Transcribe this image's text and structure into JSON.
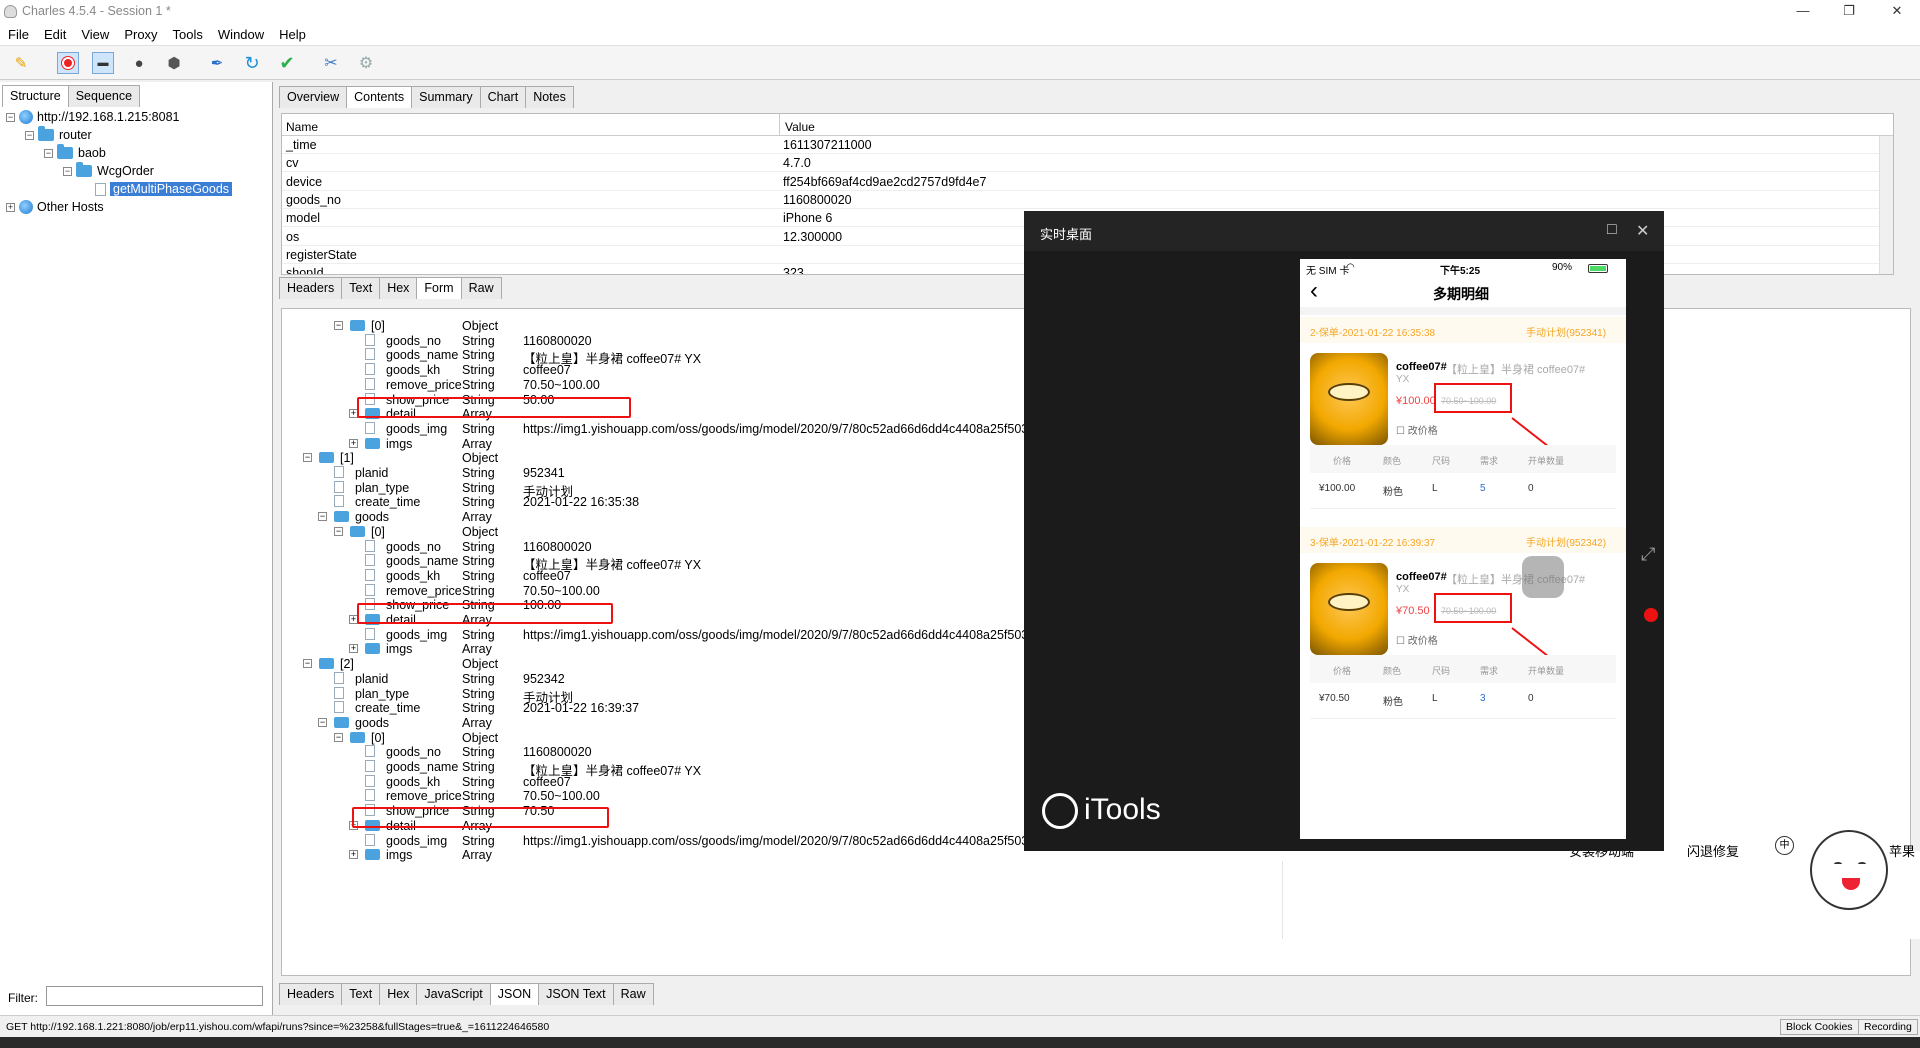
{
  "window": {
    "title": "Charles 4.5.4 - Session 1 *",
    "minimize": "—",
    "restore": "❐",
    "close": "✕"
  },
  "menu": [
    "File",
    "Edit",
    "View",
    "Proxy",
    "Tools",
    "Window",
    "Help"
  ],
  "toolbar_icons": [
    "broom-icon",
    "record-icon",
    "throttle-icon",
    "turtle-icon",
    "stop-icon",
    "pen-icon",
    "refresh-icon",
    "check-icon",
    "tools-icon",
    "settings-icon"
  ],
  "left": {
    "tabs": [
      "Structure",
      "Sequence"
    ],
    "tree": [
      {
        "label": "http://192.168.1.215:8081",
        "indent": 0,
        "icon": "globe",
        "exp": "⊟"
      },
      {
        "label": "router",
        "indent": 1,
        "icon": "folder",
        "exp": "⊟"
      },
      {
        "label": "baob",
        "indent": 2,
        "icon": "folder",
        "exp": "⊟"
      },
      {
        "label": "WcgOrder",
        "indent": 3,
        "icon": "folder",
        "exp": "⊟"
      },
      {
        "label": "getMultiPhaseGoods",
        "indent": 4,
        "icon": "doc",
        "exp": "",
        "selected": true
      },
      {
        "label": "Other Hosts",
        "indent": 0,
        "icon": "globe",
        "exp": "⊞"
      }
    ],
    "filter_label": "Filter:"
  },
  "right": {
    "top_tabs": [
      "Overview",
      "Contents",
      "Summary",
      "Chart",
      "Notes"
    ],
    "table_headers": [
      "Name",
      "Value"
    ],
    "table_rows": [
      {
        "name": "_time",
        "value": "1611307211000"
      },
      {
        "name": "cv",
        "value": "4.7.0"
      },
      {
        "name": "device",
        "value": "ff254bf669af4cd9ae2cd2757d9fd4e7"
      },
      {
        "name": "goods_no",
        "value": "1160800020"
      },
      {
        "name": "model",
        "value": "iPhone 6"
      },
      {
        "name": "os",
        "value": "12.300000"
      },
      {
        "name": "registerState",
        "value": ""
      },
      {
        "name": "shopId",
        "value": "323"
      }
    ],
    "request_tabs": [
      "Headers",
      "Text",
      "Hex",
      "Form",
      "Raw"
    ],
    "response_tabs": [
      "Headers",
      "Text",
      "Hex",
      "JavaScript",
      "JSON",
      "JSON Text",
      "Raw"
    ],
    "json_rows": [
      {
        "level": 3,
        "key": "[0]",
        "type": "Object",
        "value": "",
        "kind": "folder",
        "exp": "⊟"
      },
      {
        "level": 4,
        "key": "goods_no",
        "type": "String",
        "value": "1160800020",
        "kind": "doc"
      },
      {
        "level": 4,
        "key": "goods_name",
        "type": "String",
        "value": "【粒上皇】半身裙  coffee07#  YX",
        "kind": "doc"
      },
      {
        "level": 4,
        "key": "goods_kh",
        "type": "String",
        "value": "coffee07",
        "kind": "doc"
      },
      {
        "level": 4,
        "key": "remove_price",
        "type": "String",
        "value": "70.50~100.00",
        "kind": "doc"
      },
      {
        "level": 4,
        "key": "show_price",
        "type": "String",
        "value": "50.00",
        "kind": "doc"
      },
      {
        "level": 4,
        "key": "detail",
        "type": "Array",
        "value": "",
        "kind": "folder",
        "exp": "⊞"
      },
      {
        "level": 4,
        "key": "goods_img",
        "type": "String",
        "value": "https://img1.yishouapp.com/oss/goods/img/model/2020/9/7/80c52ad66d6dd4c4408a25f503feb19c.jpg?x-oss-process=image/resize,w_75",
        "kind": "doc"
      },
      {
        "level": 4,
        "key": "imgs",
        "type": "Array",
        "value": "",
        "kind": "folder",
        "exp": "⊞"
      },
      {
        "level": 1,
        "key": "[1]",
        "type": "Object",
        "value": "",
        "kind": "folder",
        "exp": "⊟"
      },
      {
        "level": 2,
        "key": "planid",
        "type": "String",
        "value": "952341",
        "kind": "doc"
      },
      {
        "level": 2,
        "key": "plan_type",
        "type": "String",
        "value": "手动计划",
        "kind": "doc"
      },
      {
        "level": 2,
        "key": "create_time",
        "type": "String",
        "value": "2021-01-22 16:35:38",
        "kind": "doc"
      },
      {
        "level": 2,
        "key": "goods",
        "type": "Array",
        "value": "",
        "kind": "folder",
        "exp": "⊟"
      },
      {
        "level": 3,
        "key": "[0]",
        "type": "Object",
        "value": "",
        "kind": "folder",
        "exp": "⊟"
      },
      {
        "level": 4,
        "key": "goods_no",
        "type": "String",
        "value": "1160800020",
        "kind": "doc"
      },
      {
        "level": 4,
        "key": "goods_name",
        "type": "String",
        "value": "【粒上皇】半身裙  coffee07#  YX",
        "kind": "doc"
      },
      {
        "level": 4,
        "key": "goods_kh",
        "type": "String",
        "value": "coffee07",
        "kind": "doc"
      },
      {
        "level": 4,
        "key": "remove_price",
        "type": "String",
        "value": "70.50~100.00",
        "kind": "doc"
      },
      {
        "level": 4,
        "key": "show_price",
        "type": "String",
        "value": "100.00",
        "kind": "doc"
      },
      {
        "level": 4,
        "key": "detail",
        "type": "Array",
        "value": "",
        "kind": "folder",
        "exp": "⊞"
      },
      {
        "level": 4,
        "key": "goods_img",
        "type": "String",
        "value": "https://img1.yishouapp.com/oss/goods/img/model/2020/9/7/80c52ad66d6dd4c4408a25f503feb19c.jpg?x-oss-process=image/resize,w_75",
        "kind": "doc"
      },
      {
        "level": 4,
        "key": "imgs",
        "type": "Array",
        "value": "",
        "kind": "folder",
        "exp": "⊞"
      },
      {
        "level": 1,
        "key": "[2]",
        "type": "Object",
        "value": "",
        "kind": "folder",
        "exp": "⊟"
      },
      {
        "level": 2,
        "key": "planid",
        "type": "String",
        "value": "952342",
        "kind": "doc"
      },
      {
        "level": 2,
        "key": "plan_type",
        "type": "String",
        "value": "手动计划",
        "kind": "doc"
      },
      {
        "level": 2,
        "key": "create_time",
        "type": "String",
        "value": "2021-01-22 16:39:37",
        "kind": "doc"
      },
      {
        "level": 2,
        "key": "goods",
        "type": "Array",
        "value": "",
        "kind": "folder",
        "exp": "⊟"
      },
      {
        "level": 3,
        "key": "[0]",
        "type": "Object",
        "value": "",
        "kind": "folder",
        "exp": "⊟"
      },
      {
        "level": 4,
        "key": "goods_no",
        "type": "String",
        "value": "1160800020",
        "kind": "doc"
      },
      {
        "level": 4,
        "key": "goods_name",
        "type": "String",
        "value": "【粒上皇】半身裙  coffee07#  YX",
        "kind": "doc"
      },
      {
        "level": 4,
        "key": "goods_kh",
        "type": "String",
        "value": "coffee07",
        "kind": "doc"
      },
      {
        "level": 4,
        "key": "remove_price",
        "type": "String",
        "value": "70.50~100.00",
        "kind": "doc"
      },
      {
        "level": 4,
        "key": "show_price",
        "type": "String",
        "value": "70.50",
        "kind": "doc"
      },
      {
        "level": 4,
        "key": "detail",
        "type": "Array",
        "value": "",
        "kind": "folder",
        "exp": "⊞"
      },
      {
        "level": 4,
        "key": "goods_img",
        "type": "String",
        "value": "https://img1.yishouapp.com/oss/goods/img/model/2020/9/7/80c52ad66d6dd4c4408a25f503feb19c.jpg?x-oss-process=image/resize,w_75",
        "kind": "doc"
      },
      {
        "level": 4,
        "key": "imgs",
        "type": "Array",
        "value": "",
        "kind": "folder",
        "exp": "⊞"
      }
    ]
  },
  "status": {
    "url": "GET http://192.168.1.221:8080/job/erp11.yishou.com/wfapi/runs?since=%23258&fullStages=true&_=1611224646580",
    "block_cookies": "Block Cookies",
    "recording": "Recording"
  },
  "itools": {
    "title": "实时桌面",
    "maximize": "□",
    "close": "✕",
    "brand": "iTools",
    "phone": {
      "carrier": "无 SIM 卡",
      "time": "下午5:25",
      "battery": "90%",
      "back": "‹",
      "page_title": "多期明细",
      "plans": [
        {
          "header": "2-保单-2021-01-22 16:35:38",
          "plan": "手动计划(952341)",
          "name_strong": "coffee07#",
          "name_rest": "【粒上皇】半身裙  coffee07#",
          "yx": "YX",
          "price": "¥100.00",
          "old": "70.50~100.00",
          "edit": "改价格",
          "col_headers": [
            "价格",
            "颜色",
            "尺码",
            "需求",
            "开单数量"
          ],
          "cells": [
            "¥100.00",
            "粉色",
            "L",
            "5",
            "0"
          ]
        },
        {
          "header": "3-保单-2021-01-22 16:39:37",
          "plan": "手动计划(952342)",
          "name_strong": "coffee07#",
          "name_rest": "【粒上皇】半身裙  coffee07#",
          "yx": "YX",
          "price": "¥70.50",
          "old": "70.50~100.00",
          "edit": "改价格",
          "col_headers": [
            "价格",
            "颜色",
            "尺码",
            "需求",
            "开单数量"
          ],
          "cells": [
            "¥70.50",
            "粉色",
            "L",
            "3",
            "0"
          ]
        }
      ]
    }
  },
  "background_app": {
    "items": [
      "安装移动端",
      "闪退修复",
      "苹果"
    ],
    "zh": "中"
  },
  "colors": {
    "accent": "#3b7ed6",
    "red": "#e11",
    "orange": "#f5a623",
    "price_red": "#f04444"
  }
}
